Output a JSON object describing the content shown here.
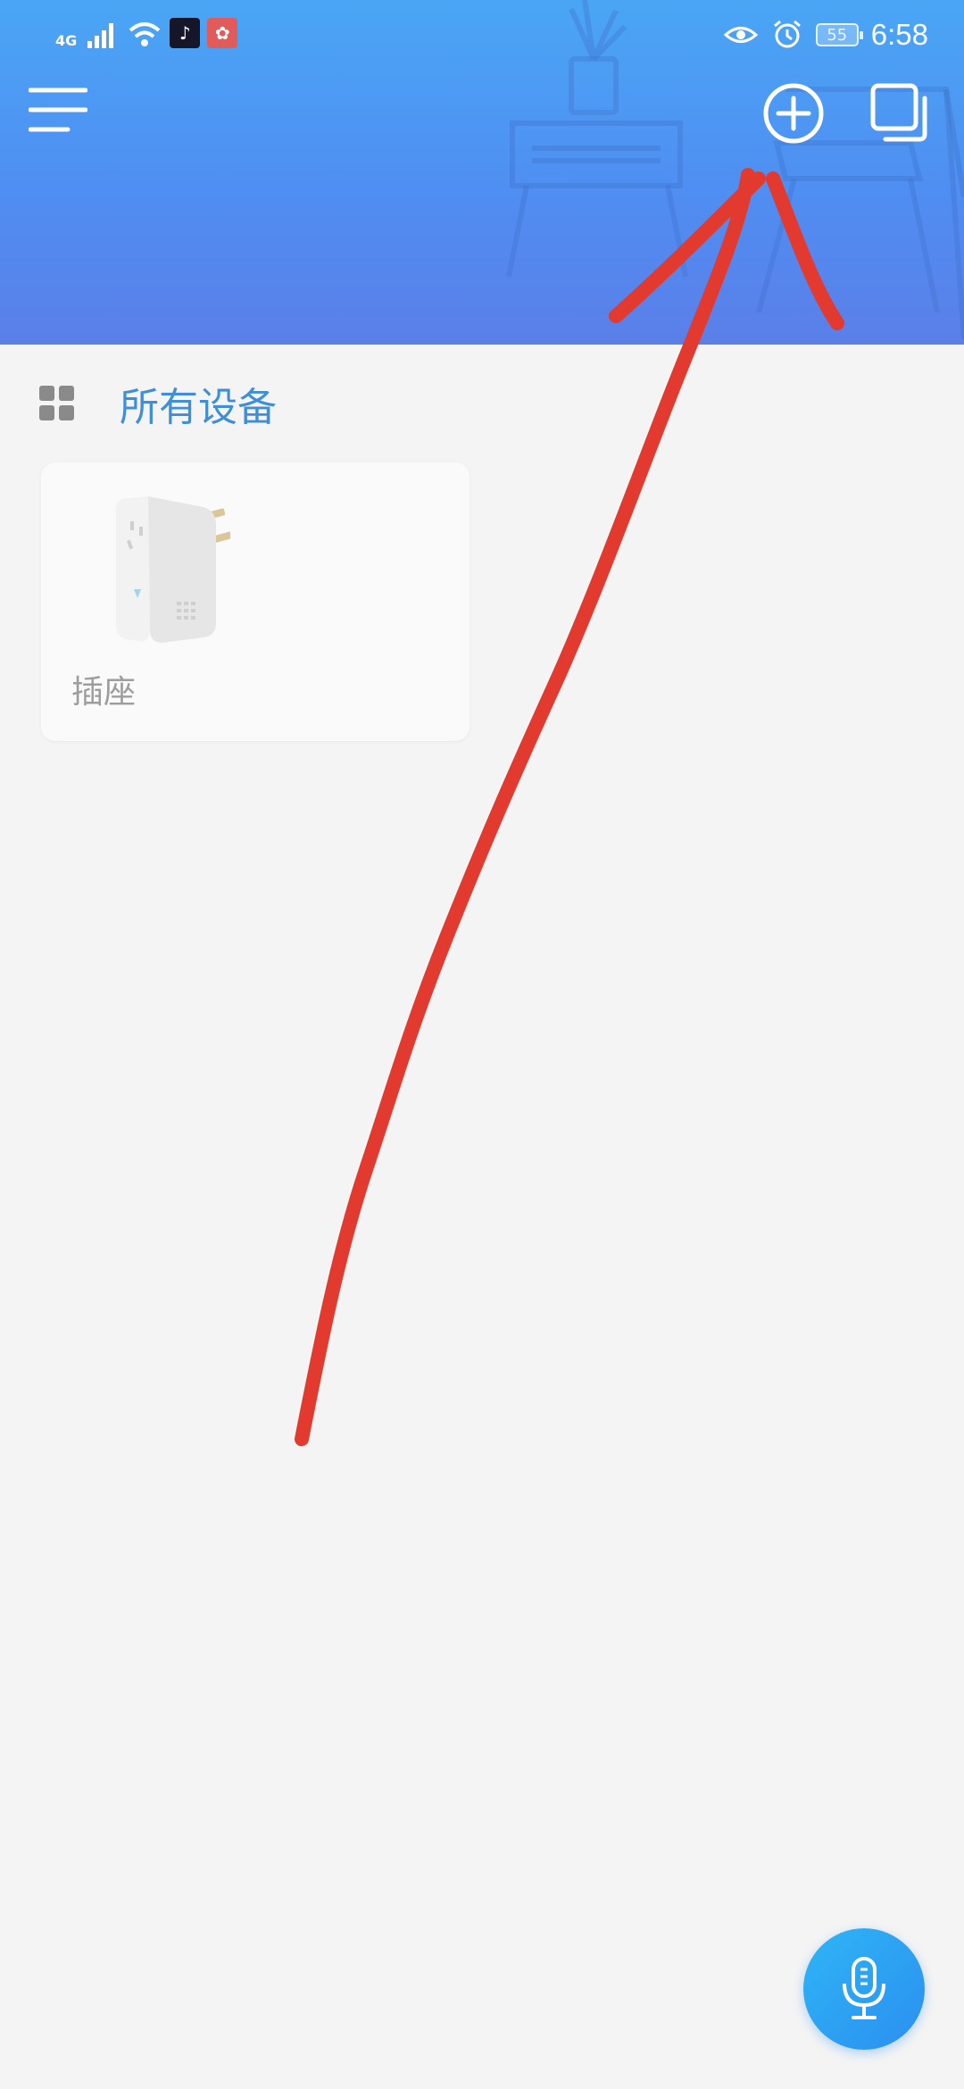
{
  "status_bar": {
    "network": "4G",
    "battery": "55",
    "time": "6:58"
  },
  "icons": {
    "menu": "hamburger-menu-icon",
    "add": "add-circle-icon",
    "window": "multi-window-icon",
    "grid": "grid-icon",
    "mic": "microphone-icon"
  },
  "section": {
    "title": "所有设备"
  },
  "devices": [
    {
      "name": "插座",
      "icon": "smart-plug-image"
    }
  ],
  "colors": {
    "header_top": "#4aa6f5",
    "header_bottom": "#5b7fe8",
    "accent": "#3f8fd8",
    "annotation": "#e23a2e"
  }
}
